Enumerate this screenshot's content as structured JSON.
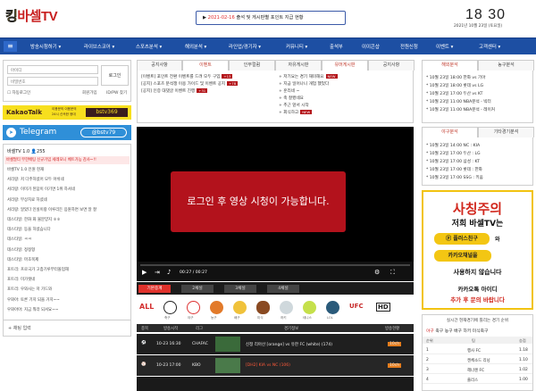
{
  "header": {
    "logo_prefix": "킹",
    "logo_main": "바셀TV",
    "notice_date": "2021-02-16",
    "notice_text": " 출석 및 게시판별 포인트 지급 현황",
    "clock": "18 30",
    "date": "2021년 10월 23일 (토요일)"
  },
  "nav": {
    "items": [
      "방송시청하기 ▾",
      "라이브스코어 ▾",
      "스포츠분석 ▾",
      "해외분석 ▾",
      "라인업/경기자 ▾",
      "커뮤니티 ▾",
      "출석부",
      "이이콘샵",
      "전원신청",
      "이벤트 ▾",
      "고객센터 ▾"
    ]
  },
  "login": {
    "id_placeholder": "아이디",
    "pw_placeholder": "비밀번호",
    "button": "로그인",
    "remember": "자동로그인",
    "join": "회원가입",
    "find": "ID/PW 찾기"
  },
  "kakao": {
    "label": "KakaoTalk",
    "desc1": "이용문의 이용문의",
    "desc2": "24시 신속한 응대",
    "id": "bstv369"
  },
  "telegram": {
    "label": "Telegram",
    "id": "@bstv79"
  },
  "chat": {
    "title": "바셀TV 1.0",
    "count": "255",
    "notice": "바셀멀티 무한배팅 신규가입 세레모니 베트가능 감사~!!",
    "messages": [
      "바셀TV 1.0 인원 현재",
      "서리랑: 저 다주하셨어 모두 아쉬네",
      "서리랑: 이미가 된답이 이기면 1위 하셔네",
      "서리랑: 부상치료 하셨네",
      "서리랑: 알았다 인실이랑 이루리든 응원하면 보면 알 잘",
      "데스타일: 한화 화 불분양지 ㅎㅎ",
      "데스타일: 등을 하셨습니다",
      "데스타일: ㅋㅋ",
      "데스타일: 정정형",
      "데스타일: 마초복제",
      "포트리: 프로국가 고층기루부터올업해",
      "포트리: 미가렛네",
      "포트리: 우와사는 저 가드와",
      "우와아: 토론 기지 되을 거지~~",
      "우와아아: 지금 뭐라 되셔요~~"
    ],
    "input_placeholder": "채팅 입력"
  },
  "board": {
    "tabs": [
      "공지사항",
      "이벤트",
      "인부컬럼",
      "자유게시판",
      "유머게시판",
      "공지사항"
    ],
    "left_items": [
      "[이벤트] 포인트 전환 이벤트를 드려 모두 구입",
      "[공지] 스포츠 분석쟁 이용 가이드 및 이벤트 공지",
      "[공지] 인증 대댓글 이벤트 진행"
    ],
    "left_badges": [
      "+13",
      "+78",
      "+31"
    ],
    "right_items": [
      "+ 저기요는 경기 재미해요",
      "+ 지금 일어나니 개업 했었다",
      "+ 훈리네 ~",
      "+ 축 잘봤네요",
      "+ 추근 앞서 시작",
      "+ 회식하고"
    ],
    "right_badges": [
      "NEW",
      "",
      "",
      "",
      "",
      "NEW"
    ]
  },
  "analysis": {
    "tabs": [
      "해외분석",
      "농구분석"
    ],
    "items": [
      "* 10월 23일 18:00 한화 vs 기아",
      "* 10월 23일 18:00 롯데 vs LG",
      "* 10월 23일 17:00 두산 vs KT",
      "* 10월 23일 11:00 NBA분석 - 빅터",
      "* 10월 23일 11:00 NBA분석 - 레이커"
    ]
  },
  "schedule": {
    "tabs": [
      "야구분석",
      "기타경기분석"
    ],
    "items": [
      "* 10월 23일 14:00 NC : KIA",
      "* 10월 23일 17:00 두산 : LG",
      "* 10월 23일 17:00 삼성 : KT",
      "* 10월 23일 17:00 롯데 : 한화",
      "* 10월 23일 17:00 SSG : 키움"
    ]
  },
  "video": {
    "overlay": "로그인 후 영상 시청이 가능합니다.",
    "time": "00:27 / 00:27"
  },
  "channels": [
    "기본중계",
    "2채널",
    "3채널",
    "4채널"
  ],
  "sports_icons": [
    "ALL",
    "soccer-icon",
    "baseball-icon",
    "basketball-icon",
    "volleyball-icon",
    "football-icon",
    "hockey-icon",
    "tennis-icon",
    "lol-icon",
    "ufc-icon",
    "hd-icon"
  ],
  "sports_labels": [
    "전체",
    "축구",
    "야구",
    "농구",
    "배구",
    "미식",
    "하키",
    "테니스",
    "LOL",
    "UFC",
    "HD"
  ],
  "match_headers": [
    "종목",
    "방송시작",
    "리그",
    "",
    "경기정보",
    "방송현황"
  ],
  "matches": [
    {
      "time": "10-23 16:30",
      "league": "CHAFAC",
      "info": "신정 리아산 [orange] vs 유한 FC (white) (174)",
      "status": "10ch"
    },
    {
      "time": "10-23 17:00",
      "league": "KBO",
      "info": "[DH2] KIA vs NC (106)",
      "status": "10ch"
    }
  ],
  "ad": {
    "title": "사칭주의",
    "line1": "저희 바셀TV는",
    "line2": "플러스친구",
    "line3": "와",
    "line4": "카카오채널을",
    "line5": "사용하지 않습니다",
    "line6": "카카오톡 아이디",
    "line7": "추가 후 문의 바랍니다"
  },
  "ranking": {
    "title": "실시간 현재경기에 틀리는 경기 순위",
    "tabs": [
      "야구",
      "축구",
      "농구",
      "배구",
      "하키",
      "미식축구"
    ],
    "headers": [
      "순위",
      "팀",
      "승점"
    ],
    "rows": [
      [
        "1",
        "행사 FC",
        "1.18"
      ],
      [
        "2",
        "켄체소드 리닝",
        "1.10"
      ],
      [
        "3",
        "헤너렌 FC",
        "1.02"
      ],
      [
        "4",
        "줄리스",
        "1.00"
      ]
    ]
  }
}
